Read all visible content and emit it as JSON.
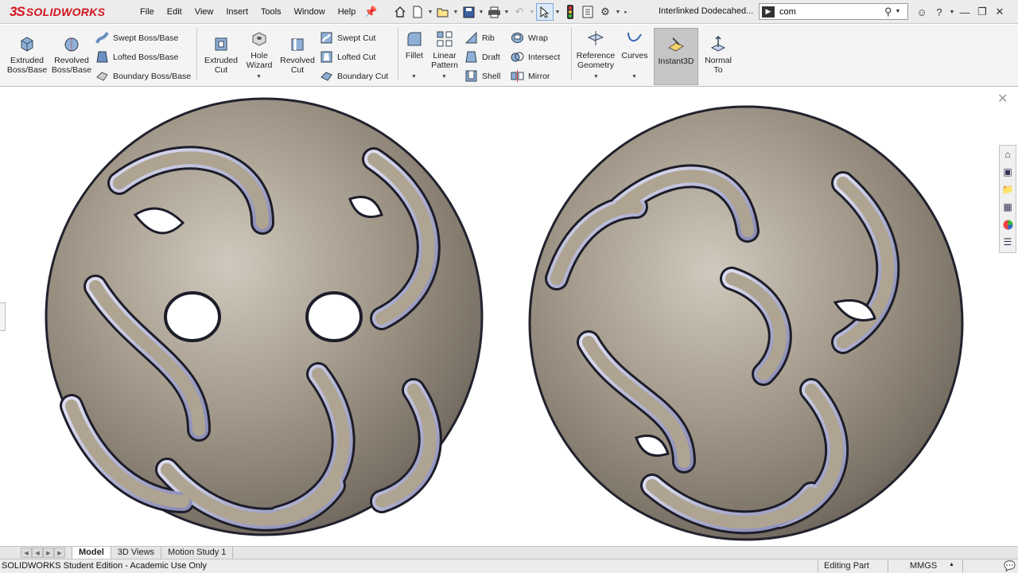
{
  "app": {
    "logo_text": "SOLIDWORKS",
    "logo_prefix": "3S"
  },
  "menu": [
    "File",
    "Edit",
    "View",
    "Insert",
    "Tools",
    "Window",
    "Help"
  ],
  "document_title": "Interlinked Dodecahed...",
  "search": {
    "value": "com"
  },
  "ribbon": {
    "extruded_boss": "Extruded Boss/Base",
    "revolved_boss": "Revolved Boss/Base",
    "swept_boss": "Swept Boss/Base",
    "lofted_boss": "Lofted Boss/Base",
    "boundary_boss": "Boundary Boss/Base",
    "extruded_cut": "Extruded Cut",
    "hole_wizard": "Hole Wizard",
    "revolved_cut": "Revolved Cut",
    "swept_cut": "Swept Cut",
    "lofted_cut": "Lofted Cut",
    "boundary_cut": "Boundary Cut",
    "fillet": "Fillet",
    "linear_pattern": "Linear Pattern",
    "rib": "Rib",
    "draft": "Draft",
    "shell": "Shell",
    "wrap": "Wrap",
    "intersect": "Intersect",
    "mirror": "Mirror",
    "reference_geometry": "Reference Geometry",
    "curves": "Curves",
    "instant3d": "Instant3D",
    "normal_to": "Normal To"
  },
  "tabs": [
    "Model",
    "3D Views",
    "Motion Study 1"
  ],
  "status": {
    "edition": "SOLIDWORKS Student Edition - Academic Use Only",
    "mode": "Editing Part",
    "units": "MMGS"
  },
  "colors": {
    "brand": "#d2141e",
    "model_base": "#a89f92",
    "model_edge": "#2a2a3c"
  },
  "icons": [
    "home-icon",
    "new-icon",
    "open-icon",
    "save-icon",
    "print-icon",
    "undo-icon",
    "select-icon",
    "traffic-light-icon",
    "file-properties-icon",
    "options-icon",
    "search-icon",
    "user-icon",
    "help-icon",
    "minimize-icon",
    "restore-icon",
    "close-icon"
  ]
}
